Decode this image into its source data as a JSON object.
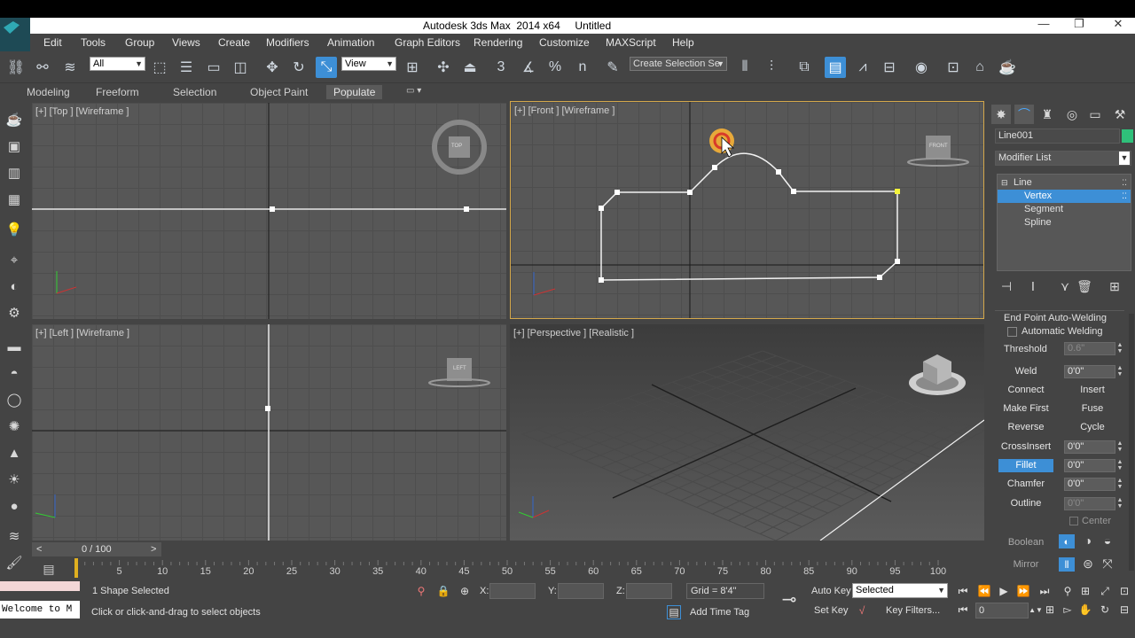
{
  "title": "Autodesk 3ds Max  2014 x64     Untitled",
  "window_controls": {
    "minimize": "—",
    "restore": "❐",
    "close": "✕"
  },
  "menu": [
    "Edit",
    "Tools",
    "Group",
    "Views",
    "Create",
    "Modifiers",
    "Animation",
    "Graph Editors",
    "Rendering",
    "Customize",
    "MAXScript",
    "Help"
  ],
  "toolbar": {
    "selection_filter": "All",
    "ref_coord": "View",
    "named_selection_placeholder": "Create Selection Se",
    "snap_labels": [
      "3",
      "%",
      "n"
    ]
  },
  "ribbon": {
    "tabs": [
      "Modeling",
      "Freeform",
      "Selection",
      "Object Paint",
      "Populate"
    ],
    "active": "Populate"
  },
  "viewports": {
    "top": {
      "label": "[+] [Top ] [Wireframe ]",
      "cube": "TOP"
    },
    "front": {
      "label": "[+] [Front ] [Wireframe ]",
      "cube": "FRONT"
    },
    "left": {
      "label": "[+] [Left ] [Wireframe ]",
      "cube": "LEFT"
    },
    "perspective": {
      "label": "[+] [Perspective ] [Realistic ]"
    }
  },
  "command_panel": {
    "object_name": "Line001",
    "object_color": "#2fc07a",
    "modifier_list": "Modifier List",
    "stack": [
      {
        "label": "Line",
        "level": 0,
        "selected": false
      },
      {
        "label": "Vertex",
        "level": 1,
        "selected": true
      },
      {
        "label": "Segment",
        "level": 1,
        "selected": false
      },
      {
        "label": "Spline",
        "level": 1,
        "selected": false
      }
    ],
    "rollout": {
      "group_title": "End Point Auto-Welding",
      "auto_weld_label": "Automatic Welding",
      "threshold_label": "Threshold",
      "threshold_value": "0.6\"",
      "weld": "Weld",
      "weld_value": "0'0\"",
      "connect": "Connect",
      "insert": "Insert",
      "make_first": "Make First",
      "fuse": "Fuse",
      "reverse": "Reverse",
      "cycle": "Cycle",
      "crossinsert": "CrossInsert",
      "crossinsert_value": "0'0\"",
      "fillet": "Fillet",
      "fillet_value": "0'0\"",
      "chamfer": "Chamfer",
      "chamfer_value": "0'0\"",
      "outline": "Outline",
      "outline_value": "0'0\"",
      "center": "Center",
      "boolean": "Boolean",
      "mirror": "Mirror"
    }
  },
  "time": {
    "slider": "0 / 100",
    "prev": "<",
    "next": ">",
    "ticks": [
      "5",
      "10",
      "15",
      "20",
      "25",
      "30",
      "35",
      "40",
      "45",
      "50",
      "55",
      "60",
      "65",
      "70",
      "75",
      "80",
      "85",
      "90",
      "95",
      "100"
    ],
    "current_frame": "0"
  },
  "status": {
    "maxscript": "Welcome to M",
    "selection": "1 Shape Selected",
    "prompt": "Click or click-and-drag to select objects",
    "x_label": "X:",
    "y_label": "Y:",
    "z_label": "Z:",
    "grid": "Grid = 8'4\"",
    "add_time_tag": "Add Time Tag",
    "auto_key": "Auto Key",
    "set_key": "Set Key",
    "key_mode": "Selected",
    "key_filters": "Key Filters...",
    "frame": "0"
  }
}
